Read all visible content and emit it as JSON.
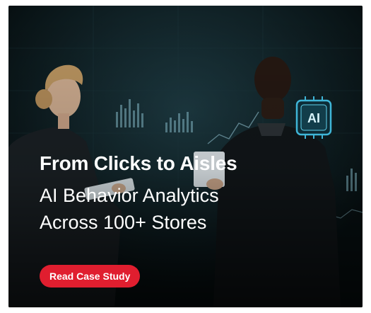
{
  "banner": {
    "headline": "From Clicks to Aisles",
    "subline_1": "AI Behavior Analytics",
    "subline_2": "Across 100+ Stores",
    "cta_label": "Read Case Study",
    "ai_badge_text": "AI"
  },
  "colors": {
    "background": "#0b1518",
    "cta": "#e01e2f",
    "accent_glow": "#3fb6d8",
    "text": "#ffffff"
  },
  "icons": [
    "ai-chip-icon"
  ]
}
